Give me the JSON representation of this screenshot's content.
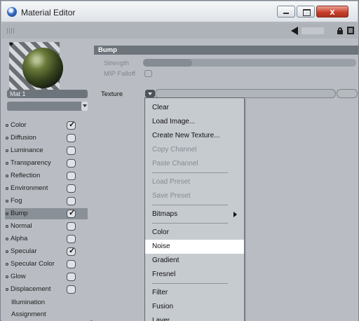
{
  "window": {
    "title": "Material Editor",
    "close_glyph": "x"
  },
  "material": {
    "name": "Mat 1"
  },
  "channels": [
    {
      "label": "Color",
      "checked": true
    },
    {
      "label": "Diffusion",
      "checked": false
    },
    {
      "label": "Luminance",
      "checked": false
    },
    {
      "label": "Transparency",
      "checked": false
    },
    {
      "label": "Reflection",
      "checked": false
    },
    {
      "label": "Environment",
      "checked": false
    },
    {
      "label": "Fog",
      "checked": false
    },
    {
      "label": "Bump",
      "checked": true,
      "selected": true
    },
    {
      "label": "Normal",
      "checked": false
    },
    {
      "label": "Alpha",
      "checked": false
    },
    {
      "label": "Specular",
      "checked": true
    },
    {
      "label": "Specular Color",
      "checked": false
    },
    {
      "label": "Glow",
      "checked": false
    },
    {
      "label": "Displacement",
      "checked": false
    }
  ],
  "extra_items": [
    "Illumination",
    "Assignment"
  ],
  "bump": {
    "header": "Bump",
    "strength_label": "Strength",
    "mip_falloff_label": "MIP Falloff",
    "texture_label": "Texture"
  },
  "context_menu": {
    "items": [
      {
        "label": "Clear",
        "enabled": true
      },
      {
        "label": "Load Image...",
        "enabled": true
      },
      {
        "label": "Create New Texture...",
        "enabled": true
      },
      {
        "label": "Copy Channel",
        "enabled": false
      },
      {
        "label": "Paste Channel",
        "enabled": false
      },
      {
        "separator": true
      },
      {
        "label": "Load Preset",
        "enabled": false
      },
      {
        "label": "Save Preset",
        "enabled": false
      },
      {
        "separator": true
      },
      {
        "label": "Bitmaps",
        "enabled": true,
        "submenu": true
      },
      {
        "separator": true
      },
      {
        "label": "Color",
        "enabled": true
      },
      {
        "label": "Noise",
        "enabled": true,
        "highlighted": true
      },
      {
        "label": "Gradient",
        "enabled": true
      },
      {
        "label": "Fresnel",
        "enabled": true
      },
      {
        "separator": true
      },
      {
        "label": "Filter",
        "enabled": true
      },
      {
        "label": "Fusion",
        "enabled": true
      },
      {
        "label": "Layer",
        "enabled": true
      }
    ]
  },
  "colors": {
    "panel": "#b9bdc3",
    "header": "#6e747c",
    "highlight": "#ffffff",
    "close_button": "#c9402c"
  },
  "icons": [
    "app-icon",
    "grip-icon",
    "back-arrow-icon",
    "lock-icon",
    "expand-icon",
    "checkbox-icon",
    "submenu-arrow-icon"
  ]
}
